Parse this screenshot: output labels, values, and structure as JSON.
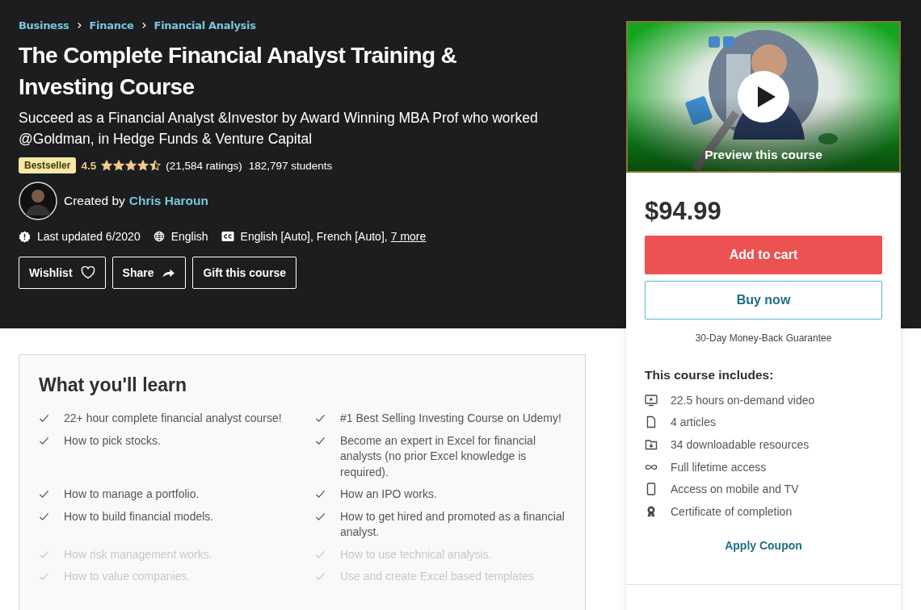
{
  "breadcrumbs": [
    "Business",
    "Finance",
    "Financial Analysis"
  ],
  "title": "The Complete Financial Analyst Training & Investing Course",
  "subtitle": "Succeed as a Financial Analyst &Investor by Award Winning MBA Prof who worked @Goldman, in Hedge Funds & Venture Capital",
  "badge": "Bestseller",
  "rating": {
    "value": "4.5",
    "stars": 4.5,
    "count": "(21,584 ratings)"
  },
  "students": "182,797 students",
  "creator": {
    "prefix": "Created by",
    "name": "Chris Haroun"
  },
  "meta": {
    "updated": "Last updated 6/2020",
    "language": "English",
    "captions": "English [Auto], French [Auto],",
    "captions_more": "7 more"
  },
  "actions": [
    {
      "label": "Wishlist",
      "kind": "heart"
    },
    {
      "label": "Share",
      "kind": "share"
    },
    {
      "label": "Gift this course",
      "kind": "none"
    }
  ],
  "preview": {
    "label": "Preview this course"
  },
  "price": "$94.99",
  "add_to_cart": "Add to cart",
  "buy_now": "Buy now",
  "guarantee": "30-Day Money-Back Guarantee",
  "includes": {
    "title": "This course includes:",
    "items": [
      {
        "kind": "video",
        "text": "22.5 hours on-demand video"
      },
      {
        "kind": "article",
        "text": "4 articles"
      },
      {
        "kind": "download",
        "text": "34 downloadable resources"
      },
      {
        "kind": "infinity",
        "text": "Full lifetime access"
      },
      {
        "kind": "mobile",
        "text": "Access on mobile and TV"
      },
      {
        "kind": "certificate",
        "text": "Certificate of completion"
      }
    ]
  },
  "coupon": "Apply Coupon",
  "learn": {
    "title": "What you'll learn",
    "items": [
      {
        "text": "22+ hour complete financial analyst course!",
        "faded": false
      },
      {
        "text": "#1 Best Selling Investing Course on Udemy!",
        "faded": false
      },
      {
        "text": "How to pick stocks.",
        "faded": false
      },
      {
        "text": "Become an expert in Excel for financial analysts (no prior Excel knowledge is required).",
        "faded": false
      },
      {
        "text": "How to manage a portfolio.",
        "faded": false
      },
      {
        "text": "How an IPO works.",
        "faded": false
      },
      {
        "text": "How to build financial models.",
        "faded": false
      },
      {
        "text": "How to get hired and promoted as a financial analyst.",
        "faded": false
      },
      {
        "text": "How risk management works.",
        "faded": true
      },
      {
        "text": "How to use technical analysis.",
        "faded": true
      },
      {
        "text": "How to value companies.",
        "faded": true
      },
      {
        "text": "Use and create Excel based templates",
        "faded": true
      }
    ]
  }
}
